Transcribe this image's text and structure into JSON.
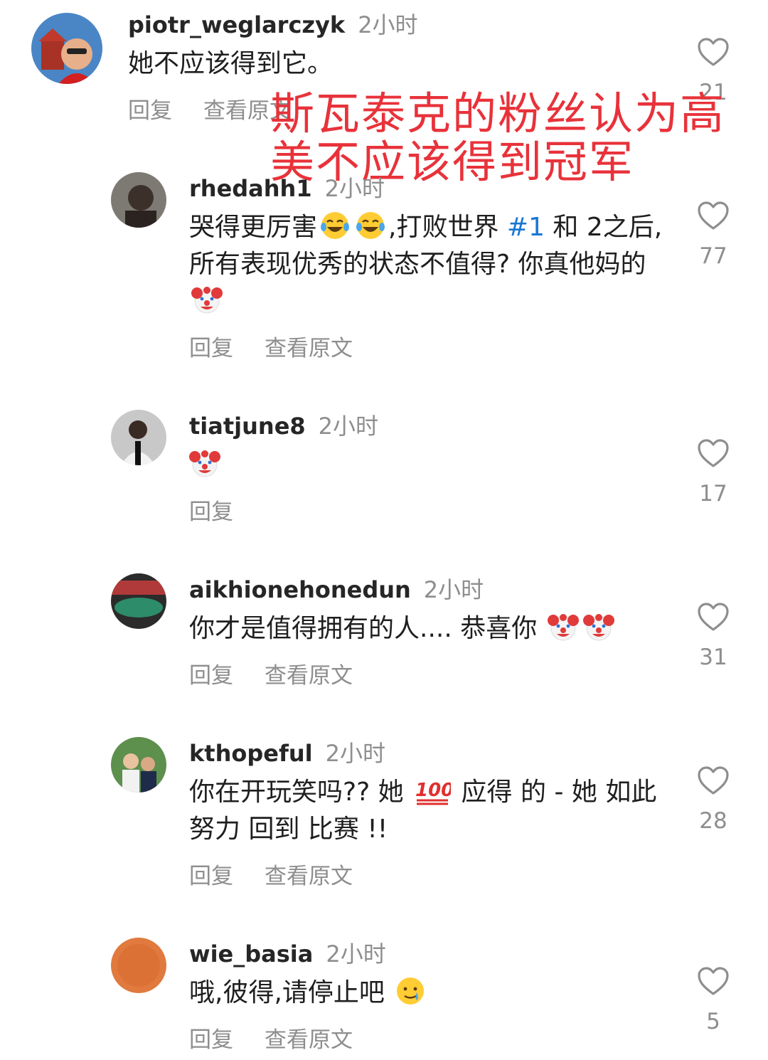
{
  "comments": [
    {
      "username": "piotr_weglarczyk",
      "time": "2小时",
      "text": "她不应该得到它。",
      "actions": [
        "回复",
        "查看原文"
      ],
      "likes": "21",
      "avatar": "avatar-piotr"
    },
    {
      "username": "rhedahh1",
      "time": "2小时",
      "text_before": "哭得更厉害",
      "text_mid": ",打败世界 ",
      "hashtag": "#1",
      "text_after": " 和 2之后,所有表现优秀的状态不值得? 你真他妈的 ",
      "actions": [
        "回复",
        "查看原文"
      ],
      "likes": "77"
    },
    {
      "username": "tiatjune8",
      "time": "2小时",
      "actions": [
        "回复"
      ],
      "likes": "17"
    },
    {
      "username": "aikhionehonedun",
      "time": "2小时",
      "text": "你才是值得拥有的人.... 恭喜你 ",
      "actions": [
        "回复",
        "查看原文"
      ],
      "likes": "31"
    },
    {
      "username": "kthopeful",
      "time": "2小时",
      "text_before": "你在开玩笑吗?? 她 ",
      "text_after": " 应得 的 - 她 如此 努力 回到 比赛 !!",
      "actions": [
        "回复",
        "查看原文"
      ],
      "likes": "28"
    },
    {
      "username": "wie_basia",
      "time": "2小时",
      "text": "哦,彼得,请停止吧 ",
      "actions": [
        "回复",
        "查看原文"
      ],
      "likes": "5"
    }
  ],
  "overlay_caption": "斯瓦泰克的粉丝认为高美不应该得到冠军",
  "colors": {
    "overlay_red": "#e8323a",
    "hashtag_blue": "#1877d2",
    "muted_gray": "#8e8e8e"
  },
  "icons": [
    "heart-outline-icon",
    "clown-emoji",
    "laughing-emoji",
    "hundred-emoji",
    "crying-smile-emoji"
  ]
}
